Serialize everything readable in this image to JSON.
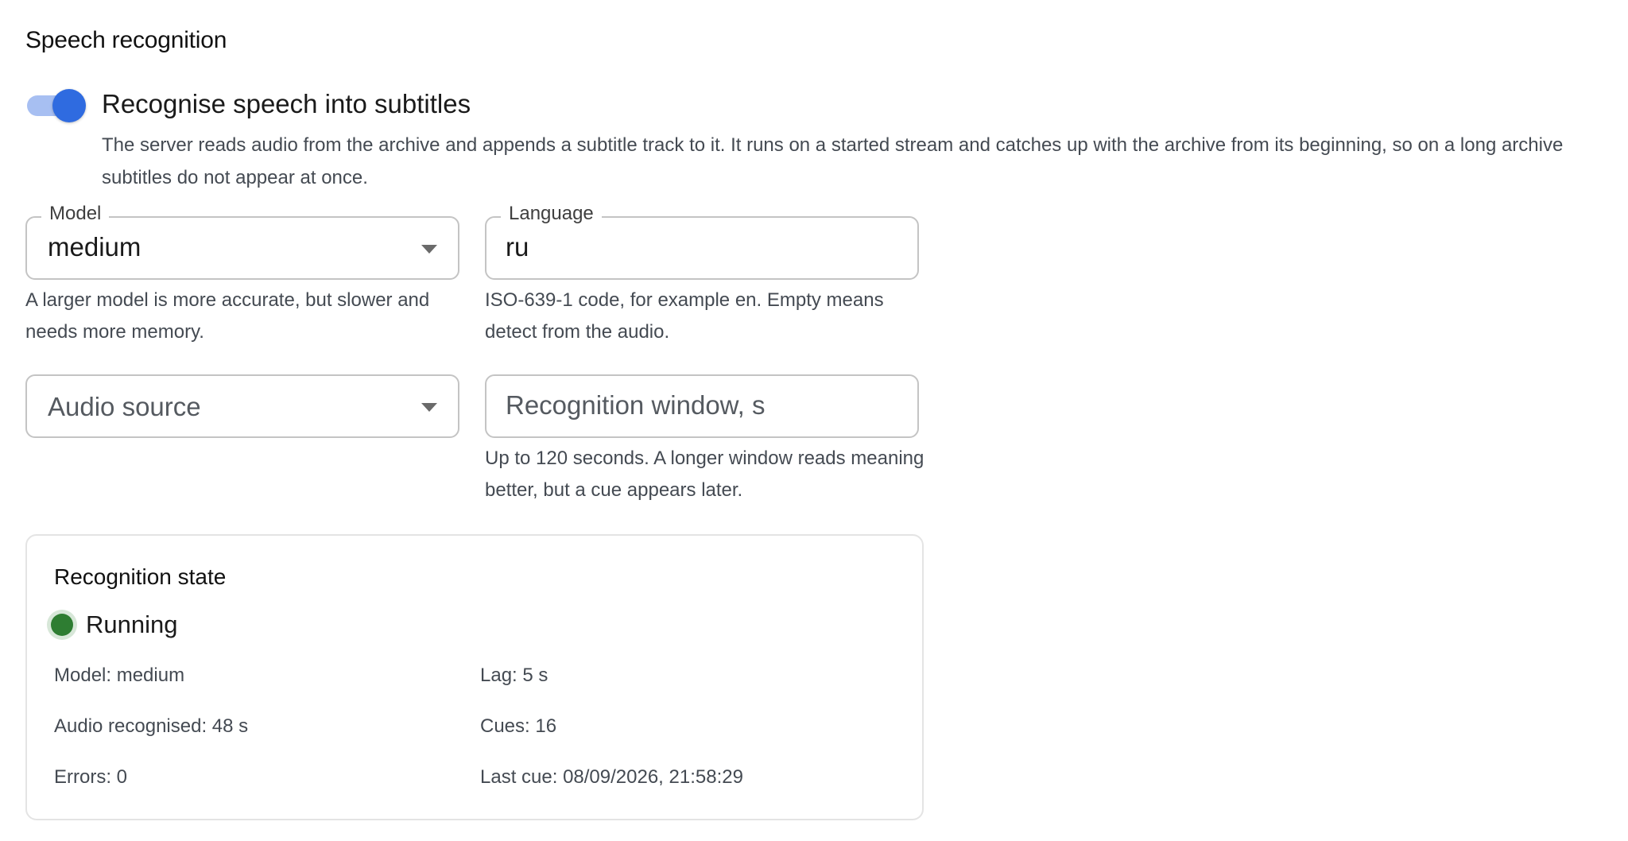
{
  "section": {
    "title": "Speech recognition"
  },
  "toggle": {
    "label": "Recognise speech into subtitles",
    "help": "The server reads audio from the archive and appends a subtitle track to it. It runs on a started stream and catches up with the archive from its beginning, so on a long archive subtitles do not appear at once.",
    "checked": true,
    "accent_color": "#2f6be0",
    "track_color": "#a7bff2"
  },
  "model_field": {
    "label": "Model",
    "value": "medium",
    "help": "A larger model is more accurate, but slower and needs more memory."
  },
  "language_field": {
    "label": "Language",
    "value": "ru",
    "help": "ISO-639-1 code, for example en. Empty means detect from the audio."
  },
  "audio_source_field": {
    "placeholder": "Audio source"
  },
  "window_field": {
    "placeholder": "Recognition window, s",
    "help": "Up to 120 seconds. A longer window reads meaning better, but a cue appears later."
  },
  "state": {
    "title": "Recognition state",
    "status": "Running",
    "status_color": "#2e7d32",
    "model": "Model: medium",
    "lag": "Lag: 5 s",
    "audio_recognised": "Audio recognised: 48 s",
    "cues": "Cues: 16",
    "errors": "Errors: 0",
    "last_cue": "Last cue: 08/09/2026, 21:58:29"
  }
}
